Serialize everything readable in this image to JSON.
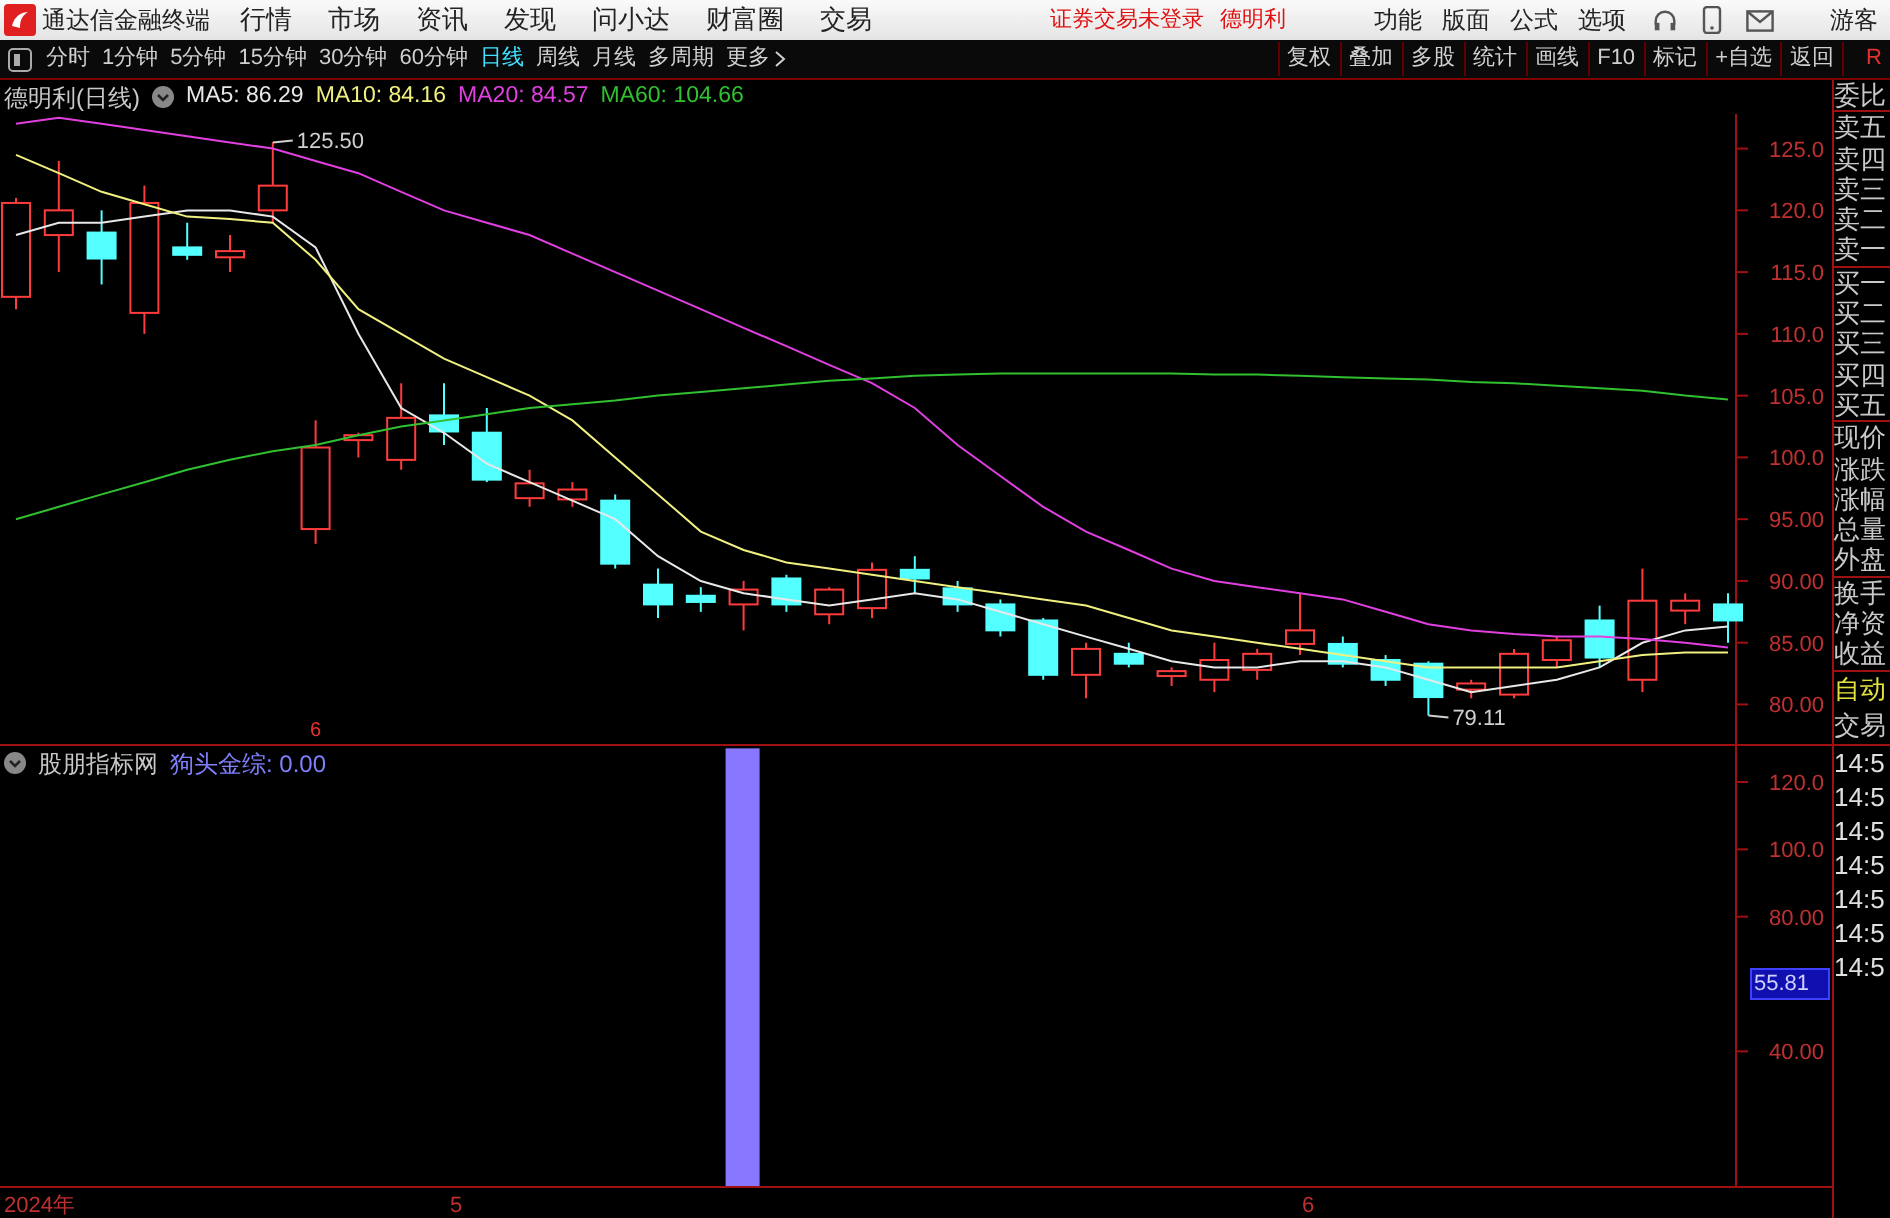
{
  "app_bar": {
    "title": "通达信金融终端",
    "menus": [
      "行情",
      "市场",
      "资讯",
      "发现",
      "问小达",
      "财富圈",
      "交易"
    ],
    "status": "证券交易未登录",
    "stock": "德明利",
    "tools": [
      "功能",
      "版面",
      "公式",
      "选项"
    ],
    "user": "游客"
  },
  "toolbar": {
    "periods": [
      {
        "label": "分时",
        "selected": false
      },
      {
        "label": "1分钟",
        "selected": false
      },
      {
        "label": "5分钟",
        "selected": false
      },
      {
        "label": "15分钟",
        "selected": false
      },
      {
        "label": "30分钟",
        "selected": false
      },
      {
        "label": "60分钟",
        "selected": false
      },
      {
        "label": "日线",
        "selected": true
      },
      {
        "label": "周线",
        "selected": false
      },
      {
        "label": "月线",
        "selected": false
      },
      {
        "label": "多周期",
        "selected": false
      },
      {
        "label": "更多",
        "selected": false
      }
    ],
    "actions": [
      "复权",
      "叠加",
      "多股",
      "统计",
      "画线",
      "F10",
      "标记",
      "+自选",
      "返回"
    ],
    "corner": "R"
  },
  "main_chart": {
    "title": "德明利(日线)",
    "high_label": "125.50",
    "low_label": "79.11",
    "date_marker": "6",
    "chart_data": {
      "type": "candlestick",
      "ylim": [
        76.8,
        127.8
      ],
      "yticks": [
        {
          "value": 125,
          "label": "125.0"
        },
        {
          "value": 120,
          "label": "120.0"
        },
        {
          "value": 115,
          "label": "115.0"
        },
        {
          "value": 110,
          "label": "110.0"
        },
        {
          "value": 105,
          "label": "105.0"
        },
        {
          "value": 100,
          "label": "100.0"
        },
        {
          "value": 95,
          "label": "95.00"
        },
        {
          "value": 90,
          "label": "90.00"
        },
        {
          "value": 85,
          "label": "85.00"
        },
        {
          "value": 80,
          "label": "80.00"
        }
      ],
      "ohlc": [
        [
          113,
          121,
          112,
          120.6
        ],
        [
          118,
          124,
          115,
          120
        ],
        [
          118.2,
          120,
          114,
          116.1
        ],
        [
          111.7,
          122,
          110,
          120.6
        ],
        [
          117,
          119,
          116,
          116.4
        ],
        [
          116.2,
          118,
          115,
          116.7
        ],
        [
          120,
          125.5,
          119,
          122
        ],
        [
          94.2,
          103,
          93,
          100.8
        ],
        [
          101.4,
          102,
          100,
          101.8
        ],
        [
          99.8,
          106,
          99,
          103.2
        ],
        [
          103.4,
          106,
          101,
          102.1
        ],
        [
          102,
          104,
          98,
          98.2
        ],
        [
          96.7,
          99,
          96,
          97.9
        ],
        [
          96.6,
          98,
          96,
          97.4
        ],
        [
          96.5,
          97,
          91,
          91.4
        ],
        [
          89.7,
          91,
          87,
          88.1
        ],
        [
          88.8,
          89.5,
          87.5,
          88.3
        ],
        [
          88.1,
          90,
          86,
          89.3
        ],
        [
          90.2,
          90.5,
          87.5,
          88.1
        ],
        [
          87.3,
          89.5,
          86.5,
          89.3
        ],
        [
          87.8,
          91.5,
          87,
          90.9
        ],
        [
          90.9,
          92,
          89,
          90.2
        ],
        [
          89.4,
          90,
          87.5,
          88.1
        ],
        [
          88.1,
          88.5,
          85.5,
          86
        ],
        [
          86.8,
          87,
          82,
          82.4
        ],
        [
          82.4,
          85,
          80.5,
          84.5
        ],
        [
          84.1,
          85,
          83,
          83.3
        ],
        [
          82.3,
          83,
          81.5,
          82.7
        ],
        [
          82,
          85,
          81,
          83.6
        ],
        [
          82.8,
          84.5,
          82,
          84.1
        ],
        [
          84.9,
          89,
          84,
          86
        ],
        [
          84.9,
          85.5,
          83,
          83.3
        ],
        [
          83.6,
          84,
          81.5,
          82
        ],
        [
          83.3,
          83.5,
          79.11,
          80.6
        ],
        [
          81.2,
          82,
          80.5,
          81.7
        ],
        [
          80.8,
          84.5,
          80.5,
          84.1
        ],
        [
          83.6,
          85.5,
          83,
          85.2
        ],
        [
          86.8,
          88,
          83,
          83.8
        ],
        [
          82,
          91,
          81,
          88.4
        ],
        [
          87.6,
          89,
          86.5,
          88.4
        ],
        [
          88.1,
          89,
          85,
          86.8
        ]
      ],
      "series": [
        {
          "name": "MA5: 86.29",
          "type": "line",
          "color": "#e8e8e8",
          "values": [
            118,
            119,
            119,
            119.5,
            120,
            120,
            119.5,
            117,
            110,
            104,
            102,
            99.5,
            98,
            96.5,
            95,
            92,
            90,
            89,
            88.5,
            88,
            88.5,
            89,
            88.5,
            87.5,
            86.5,
            85.5,
            84.5,
            83.5,
            83,
            83,
            83.5,
            83.5,
            83,
            82,
            81,
            81.5,
            82,
            83,
            85,
            86,
            86.3
          ]
        },
        {
          "name": "MA10: 84.16",
          "type": "line",
          "color": "#f0f080",
          "values": [
            124.5,
            123,
            121.5,
            120.5,
            119.5,
            119.3,
            119,
            116,
            112,
            110,
            108,
            106.5,
            105,
            103,
            100,
            97,
            94,
            92.5,
            91.5,
            91,
            90.5,
            90,
            89.5,
            89,
            88.5,
            88,
            87,
            86,
            85.5,
            85,
            84.5,
            84,
            83.5,
            83,
            83,
            83,
            83,
            83.5,
            84,
            84.2,
            84.2
          ]
        },
        {
          "name": "MA20: 84.57",
          "type": "line",
          "color": "#e040e0",
          "values": [
            127,
            127.5,
            127,
            126.5,
            126,
            125.5,
            125,
            124,
            123,
            121.5,
            120,
            119,
            118,
            116.5,
            115,
            113.5,
            112,
            110.5,
            109,
            107.5,
            106,
            104,
            101,
            98.5,
            96,
            94,
            92.5,
            91,
            90,
            89.5,
            89,
            88.5,
            87.5,
            86.5,
            86,
            85.7,
            85.5,
            85.5,
            85.3,
            85,
            84.6
          ]
        },
        {
          "name": "MA60: 104.66",
          "type": "line",
          "color": "#30c030",
          "values": [
            95,
            96,
            97,
            98,
            99,
            99.8,
            100.5,
            101,
            101.8,
            102.5,
            103,
            103.5,
            104,
            104.3,
            104.6,
            105,
            105.3,
            105.6,
            105.9,
            106.2,
            106.4,
            106.6,
            106.7,
            106.8,
            106.8,
            106.8,
            106.8,
            106.8,
            106.7,
            106.7,
            106.6,
            106.5,
            106.4,
            106.3,
            106.1,
            106,
            105.8,
            105.6,
            105.4,
            105,
            104.7
          ]
        }
      ]
    }
  },
  "indicator": {
    "name": "股朋指标网",
    "legend": "狗头金综: 0.00",
    "current_value": "55.81",
    "chart_data": {
      "type": "bar",
      "ylim": [
        0,
        130.7
      ],
      "yticks": [
        {
          "value": 120,
          "label": "120.0"
        },
        {
          "value": 100,
          "label": "100.0"
        },
        {
          "value": 80,
          "label": "80.00"
        },
        {
          "value": 40,
          "label": "40.00"
        }
      ],
      "values": [
        0,
        0,
        0,
        0,
        0,
        0,
        0,
        0,
        0,
        0,
        0,
        0,
        0,
        0,
        0,
        0,
        0,
        130,
        0,
        0,
        0,
        0,
        0,
        0,
        0,
        0,
        0,
        0,
        0,
        0,
        0,
        0,
        0,
        0,
        0,
        0,
        0,
        0,
        0,
        0,
        0
      ]
    }
  },
  "date_axis": [
    "2024年",
    "5",
    "6"
  ],
  "side_panel": {
    "groups": [
      [
        {
          "label": "委比",
          "kind": "label"
        }
      ],
      [
        {
          "label": "卖五",
          "kind": "label"
        },
        {
          "label": "卖四",
          "kind": "label"
        },
        {
          "label": "卖三",
          "kind": "label"
        },
        {
          "label": "卖二",
          "kind": "label"
        },
        {
          "label": "卖一",
          "kind": "label"
        }
      ],
      [
        {
          "label": "买一",
          "kind": "label"
        },
        {
          "label": "买二",
          "kind": "label"
        },
        {
          "label": "买三",
          "kind": "label"
        },
        {
          "label": "买四",
          "kind": "label"
        },
        {
          "label": "买五",
          "kind": "label"
        }
      ],
      [
        {
          "label": "现价",
          "kind": "label"
        },
        {
          "label": "涨跌",
          "kind": "label"
        },
        {
          "label": "涨幅",
          "kind": "label"
        },
        {
          "label": "总量",
          "kind": "label"
        },
        {
          "label": "外盘",
          "kind": "label"
        }
      ],
      [
        {
          "label": "换手",
          "kind": "label"
        },
        {
          "label": "净资",
          "kind": "label"
        },
        {
          "label": "收益",
          "kind": "label"
        }
      ],
      [
        {
          "label": "自动",
          "kind": "auto"
        },
        {
          "label": "交易",
          "kind": "label"
        }
      ],
      [
        {
          "label": "14:5",
          "kind": "time"
        },
        {
          "label": "14:5",
          "kind": "time"
        },
        {
          "label": "14:5",
          "kind": "time"
        },
        {
          "label": "14:5",
          "kind": "time"
        },
        {
          "label": "14:5",
          "kind": "time"
        },
        {
          "label": "14:5",
          "kind": "time"
        },
        {
          "label": "14:5",
          "kind": "time"
        }
      ]
    ]
  }
}
